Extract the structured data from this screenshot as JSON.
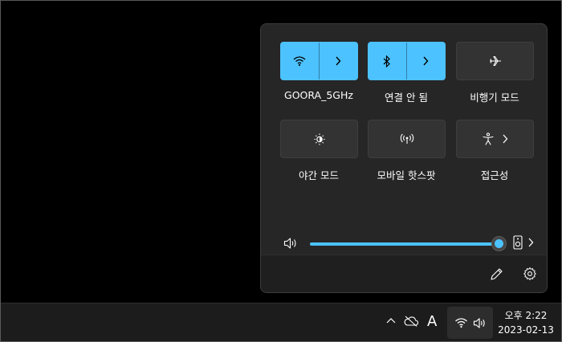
{
  "quick_settings": {
    "tiles": [
      {
        "label": "GOORA_5GHz",
        "icon": "wifi-icon",
        "active": true,
        "expandable": true
      },
      {
        "label": "연결 안 됨",
        "icon": "bluetooth-icon",
        "active": true,
        "expandable": true
      },
      {
        "label": "비행기 모드",
        "icon": "airplane-icon",
        "active": false,
        "expandable": false
      },
      {
        "label": "야간 모드",
        "icon": "night-light-icon",
        "active": false,
        "expandable": false
      },
      {
        "label": "모바일 핫스팟",
        "icon": "hotspot-icon",
        "active": false,
        "expandable": false
      },
      {
        "label": "접근성",
        "icon": "accessibility-icon",
        "active": false,
        "expandable": true
      }
    ],
    "volume": {
      "level": 1.0,
      "icon": "speaker-icon",
      "output_icon": "output-device-icon"
    },
    "footer": {
      "edit_icon": "pencil-icon",
      "settings_icon": "gear-icon"
    }
  },
  "taskbar": {
    "tray_icons": [
      "chevron-up-icon",
      "onedrive-offline-icon",
      "ime-icon"
    ],
    "ime_label": "A",
    "clock": {
      "time": "오후 2:22",
      "date": "2023-02-13"
    }
  },
  "colors": {
    "accent": "#4cc2ff",
    "panel_bg": "#262626",
    "tile_bg": "#333333",
    "taskbar_bg": "#1c1c1c"
  }
}
